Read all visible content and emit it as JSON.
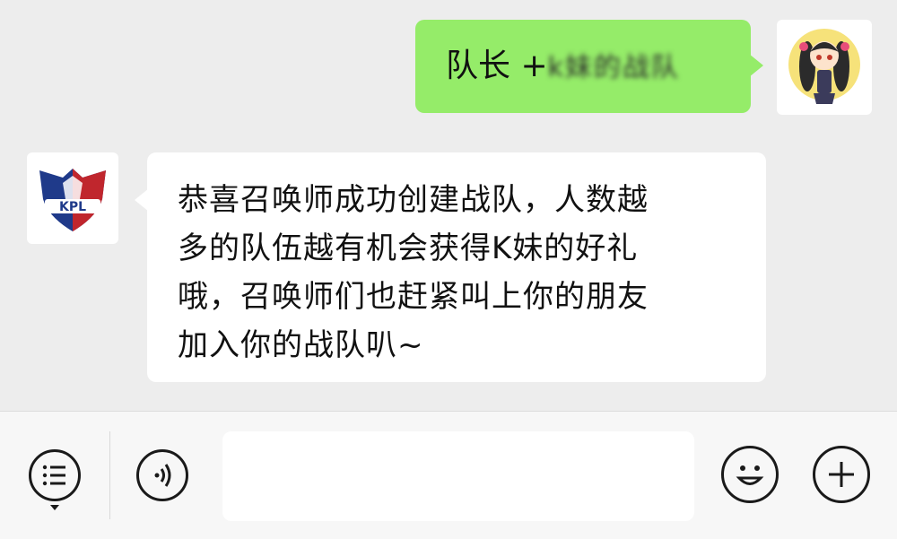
{
  "messages": {
    "sent": {
      "text_prefix": "队长 +",
      "text_obscured": "k妹的战队"
    },
    "received": {
      "lines": [
        "恭喜召唤师成功创建战队，人数越",
        "多的队伍越有机会获得K妹的好礼",
        "哦，召唤师们也赶紧叫上你的朋友",
        "加入你的战队叭~"
      ],
      "avatar_logo": "KPL"
    }
  },
  "toolbar": {
    "menu_icon": "list-menu-icon",
    "voice_icon": "voice-icon",
    "emoji_icon": "emoji-icon",
    "plus_icon": "plus-icon",
    "input_value": ""
  },
  "colors": {
    "sent_bubble": "#95ec69",
    "received_bubble": "#ffffff",
    "chat_background": "#ededed"
  }
}
